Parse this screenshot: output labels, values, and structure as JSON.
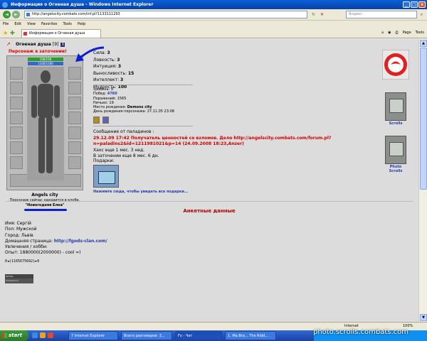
{
  "window": {
    "title": "Информация о Огненая душа - Windows Internet Explorer",
    "min": "_",
    "max": "□",
    "close": "x"
  },
  "address": {
    "url": "http://angelscity.combats.com/inf.pl?1133111293",
    "search_placeholder": "Яндекс"
  },
  "menu": [
    "File",
    "Edit",
    "View",
    "Favorites",
    "Tools",
    "Help"
  ],
  "tab": {
    "label": "Информация о Огненая душа"
  },
  "toolbar": {
    "page": "Page",
    "tools": "Tools"
  },
  "character": {
    "name": "Огненая душа",
    "level": "[9]",
    "info_mark": "i",
    "prison_label": "Персонаж в заточении!",
    "hp": "198/198",
    "mp": "1180/1180",
    "city": "Angels city",
    "club_text": "Персонаж сейчас находится в клубе.",
    "club_name": "\"Новогодняя Елка\""
  },
  "stats": [
    {
      "label": "Сила:",
      "value": "3"
    },
    {
      "label": "Ловкость:",
      "value": "3"
    },
    {
      "label": "Интуиция:",
      "value": "3"
    },
    {
      "label": "Выносливость:",
      "value": "15"
    },
    {
      "label": "Интеллект:",
      "value": "3"
    },
    {
      "label": "Мудрость:",
      "value": "100"
    }
  ],
  "info": {
    "level_label": "Уровень:",
    "level_value": "9",
    "wins_label": "Побед:",
    "wins_value": "4760",
    "losses_label": "Поражений:",
    "losses_value": "1565",
    "draws_label": "Ничьих:",
    "draws_value": "19",
    "birthplace_label": "Место рождения:",
    "birthplace_value": "Demons city",
    "birthday_label": "День рождения персонажа:",
    "birthday_value": "27.11.05 23:08"
  },
  "message": {
    "header": "Сообщение от паладинов :",
    "text": "29.12.09 17:42 Получатель ценностей со взломов. Дело http://angelscity.combats.com/forum.pl?n=paladins2&id=1211981021&p=14 (24.09.2008 18:23,Anzer)",
    "chaos": "Хаос еще 1 мес. 3 нед.",
    "prison": "В заточении еще 8 мес. 6 дн."
  },
  "gifts": {
    "header": "Подарки:",
    "link": "Нажмите сюда, чтобы увидеть все подарки..."
  },
  "right_panel": {
    "scrolls": "Scrolls",
    "photo_scrolls": "Photo Scrolls"
  },
  "profile": {
    "section_title": "Анкетные данные",
    "name": "Имя: Сергій",
    "gender": "Пол: Мужской",
    "city": "Город: Львів",
    "homepage_label": "Домашняя страница:",
    "homepage": "http://fgods-clan.com/",
    "hobby": "Увлечения / хобби:",
    "experience": "Опыт: 1880000(2000000) - cool =)",
    "id_line": "0◄(1165675692)►0",
    "banner1": "IGITALL",
    "banner2": "IYOUSOLUTI"
  },
  "statusbar": {
    "zone": "Internet",
    "zoom": "100%"
  },
  "taskbar": {
    "start": "start",
    "items": [
      "7 Internet Explorer",
      "Всего разговоров: 3...",
      "Fx - Чат",
      "1. Ma.Bra... The Ridd..."
    ]
  },
  "watermark": "photo.scrolls.combats.com"
}
